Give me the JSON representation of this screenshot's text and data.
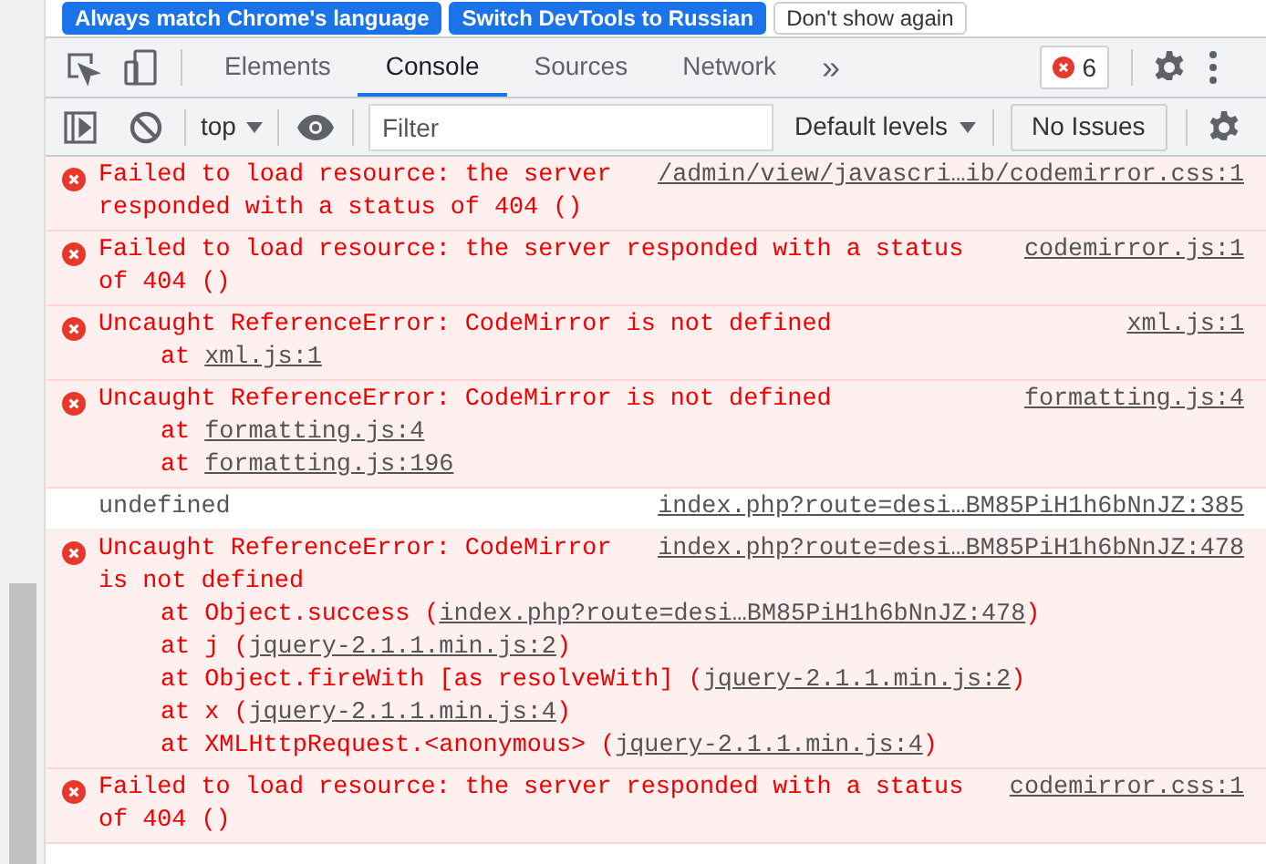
{
  "banner": {
    "buttons": [
      {
        "label": "Always match Chrome's language",
        "kind": "primary"
      },
      {
        "label": "Switch DevTools to Russian",
        "kind": "primary"
      },
      {
        "label": "Don't show again",
        "kind": "secondary"
      }
    ]
  },
  "tabs": [
    {
      "label": "Elements",
      "selected": false
    },
    {
      "label": "Console",
      "selected": true
    },
    {
      "label": "Sources",
      "selected": false
    },
    {
      "label": "Network",
      "selected": false
    }
  ],
  "more_tabs": "»",
  "error_count": "6",
  "toolbar": {
    "context": "top",
    "filter": {
      "placeholder": "Filter"
    },
    "levels": "Default levels",
    "issues": "No Issues"
  },
  "messages": [
    {
      "kind": "error",
      "text": "Failed to load resource: the server responded with a status of 404 ()",
      "source": "/admin/view/javascri…ib/codemirror.css:1"
    },
    {
      "kind": "error",
      "text": "Failed to load resource: the server responded with a status of 404 ()",
      "source": "codemirror.js:1"
    },
    {
      "kind": "error",
      "text": "Uncaught ReferenceError: CodeMirror is not defined",
      "source": "xml.js:1",
      "stack": [
        {
          "prefix": "at ",
          "link": "xml.js:1"
        }
      ]
    },
    {
      "kind": "error",
      "text": "Uncaught ReferenceError: CodeMirror is not defined",
      "source": "formatting.js:4",
      "stack": [
        {
          "prefix": "at ",
          "link": "formatting.js:4"
        },
        {
          "prefix": "at ",
          "link": "formatting.js:196"
        }
      ]
    },
    {
      "kind": "log",
      "text": "undefined",
      "source": "index.php?route=desi…BM85PiH1h6bNnJZ:385"
    },
    {
      "kind": "error",
      "text": "Uncaught ReferenceError: CodeMirror is not defined",
      "source": "index.php?route=desi…BM85PiH1h6bNnJZ:478",
      "stack": [
        {
          "prefix": "at Object.success (",
          "link": "index.php?route=desi…BM85PiH1h6bNnJZ:478",
          "suffix": ")"
        },
        {
          "prefix": "at j (",
          "link": "jquery-2.1.1.min.js:2",
          "suffix": ")"
        },
        {
          "prefix": "at Object.fireWith [as resolveWith] (",
          "link": "jquery-2.1.1.min.js:2",
          "suffix": ")"
        },
        {
          "prefix": "at x (",
          "link": "jquery-2.1.1.min.js:4",
          "suffix": ")"
        },
        {
          "prefix": "at XMLHttpRequest.<anonymous> (",
          "link": "jquery-2.1.1.min.js:4",
          "suffix": ")"
        }
      ]
    },
    {
      "kind": "error",
      "text": "Failed to load resource: the server responded with a status of 404 ()",
      "source": "codemirror.css:1"
    }
  ]
}
